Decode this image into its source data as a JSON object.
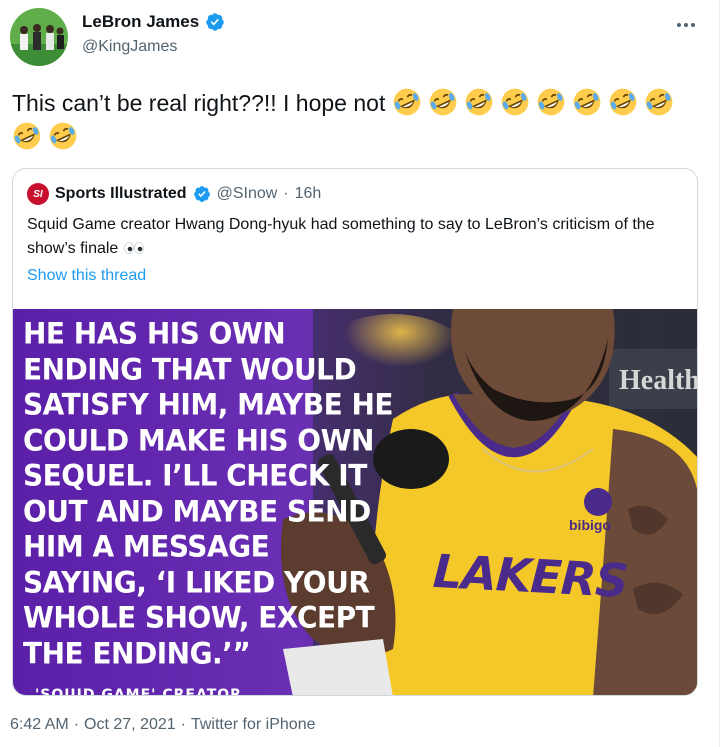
{
  "author": {
    "display_name": "LeBron James",
    "handle": "@KingJames",
    "verified": true
  },
  "tweet": {
    "text": "This can’t be real right??!! I hope not",
    "emoji": "rolling-on-floor-laughing",
    "emoji_count": 10
  },
  "quote": {
    "display_name": "Sports Illustrated",
    "logo_text": "SI",
    "handle": "@SInow",
    "separator": "·",
    "age": "16h",
    "text": "Squid Game creator Hwang Dong-hyuk had something to say to LeBron’s criticism of the show’s finale",
    "text_emoji": "eyes",
    "show_thread": "Show this thread",
    "media": {
      "lines": [
        "HE HAS HIS OWN",
        "ENDING THAT WOULD",
        "SATISFY HIM, MAYBE HE",
        "COULD MAKE HIS OWN",
        "SEQUEL. I’LL CHECK IT",
        "OUT AND MAYBE SEND",
        "HIM A MESSAGE",
        "SAYING, ‘I LIKED YOUR",
        "WHOLE SHOW, EXCEPT",
        "THE ENDING.’”"
      ],
      "credit": "'SQUID GAME' CREATOR",
      "jersey_text": "LAKERS",
      "patch_text": "bibigo",
      "banner_text": "Health"
    }
  },
  "footer": {
    "time": "6:42 AM",
    "date": "Oct 27, 2021",
    "source": "Twitter for iPhone",
    "separator": "·"
  },
  "colors": {
    "accent": "#1d9bf0",
    "secondary_text": "#536471",
    "purple": "#5b1fa8",
    "lakers_gold": "#f5c82a",
    "lakers_purple": "#4a2a8a"
  }
}
